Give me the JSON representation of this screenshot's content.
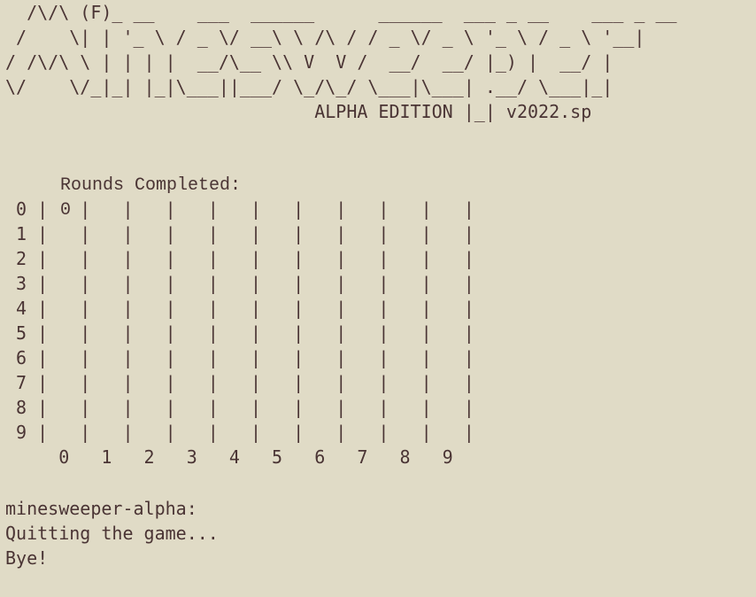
{
  "banner": {
    "lines": [
      "  /\\/\\ (F)_ __    ___  ______      ______  ___ _ __    ___ _ __",
      " /    \\| | '_ \\ / _ \\/ __\\ \\ /\\ / / _ \\/ _ \\ '_ \\ / _ \\ '__|",
      "/ /\\/\\ \\ | | | |  __/\\__ \\\\ V  V /  __/  __/ |_) |  __/ |",
      "\\/    \\/_|_| |_|\\___||___/ \\_/\\_/ \\___|\\___| .__/ \\___|_|",
      "                             ALPHA EDITION |_| v2022.sp"
    ]
  },
  "status": {
    "rounds_label": "Rounds Completed:",
    "rounds_value": "0"
  },
  "board": {
    "rows": [
      " 0 |   |   |   |   |   |   |   |   |   |   |",
      " 1 |   |   |   |   |   |   |   |   |   |   |",
      " 2 |   |   |   |   |   |   |   |   |   |   |",
      " 3 |   |   |   |   |   |   |   |   |   |   |",
      " 4 |   |   |   |   |   |   |   |   |   |   |",
      " 5 |   |   |   |   |   |   |   |   |   |   |",
      " 6 |   |   |   |   |   |   |   |   |   |   |",
      " 7 |   |   |   |   |   |   |   |   |   |   |",
      " 8 |   |   |   |   |   |   |   |   |   |   |",
      " 9 |   |   |   |   |   |   |   |   |   |   |"
    ],
    "column_labels": "     0   1   2   3   4   5   6   7   8   9"
  },
  "console": {
    "prompt": "minesweeper-alpha:",
    "messages": [
      "Quitting the game...",
      "Bye!"
    ]
  },
  "colors": {
    "background": "#e0dbc6",
    "text": "#4a3434"
  }
}
